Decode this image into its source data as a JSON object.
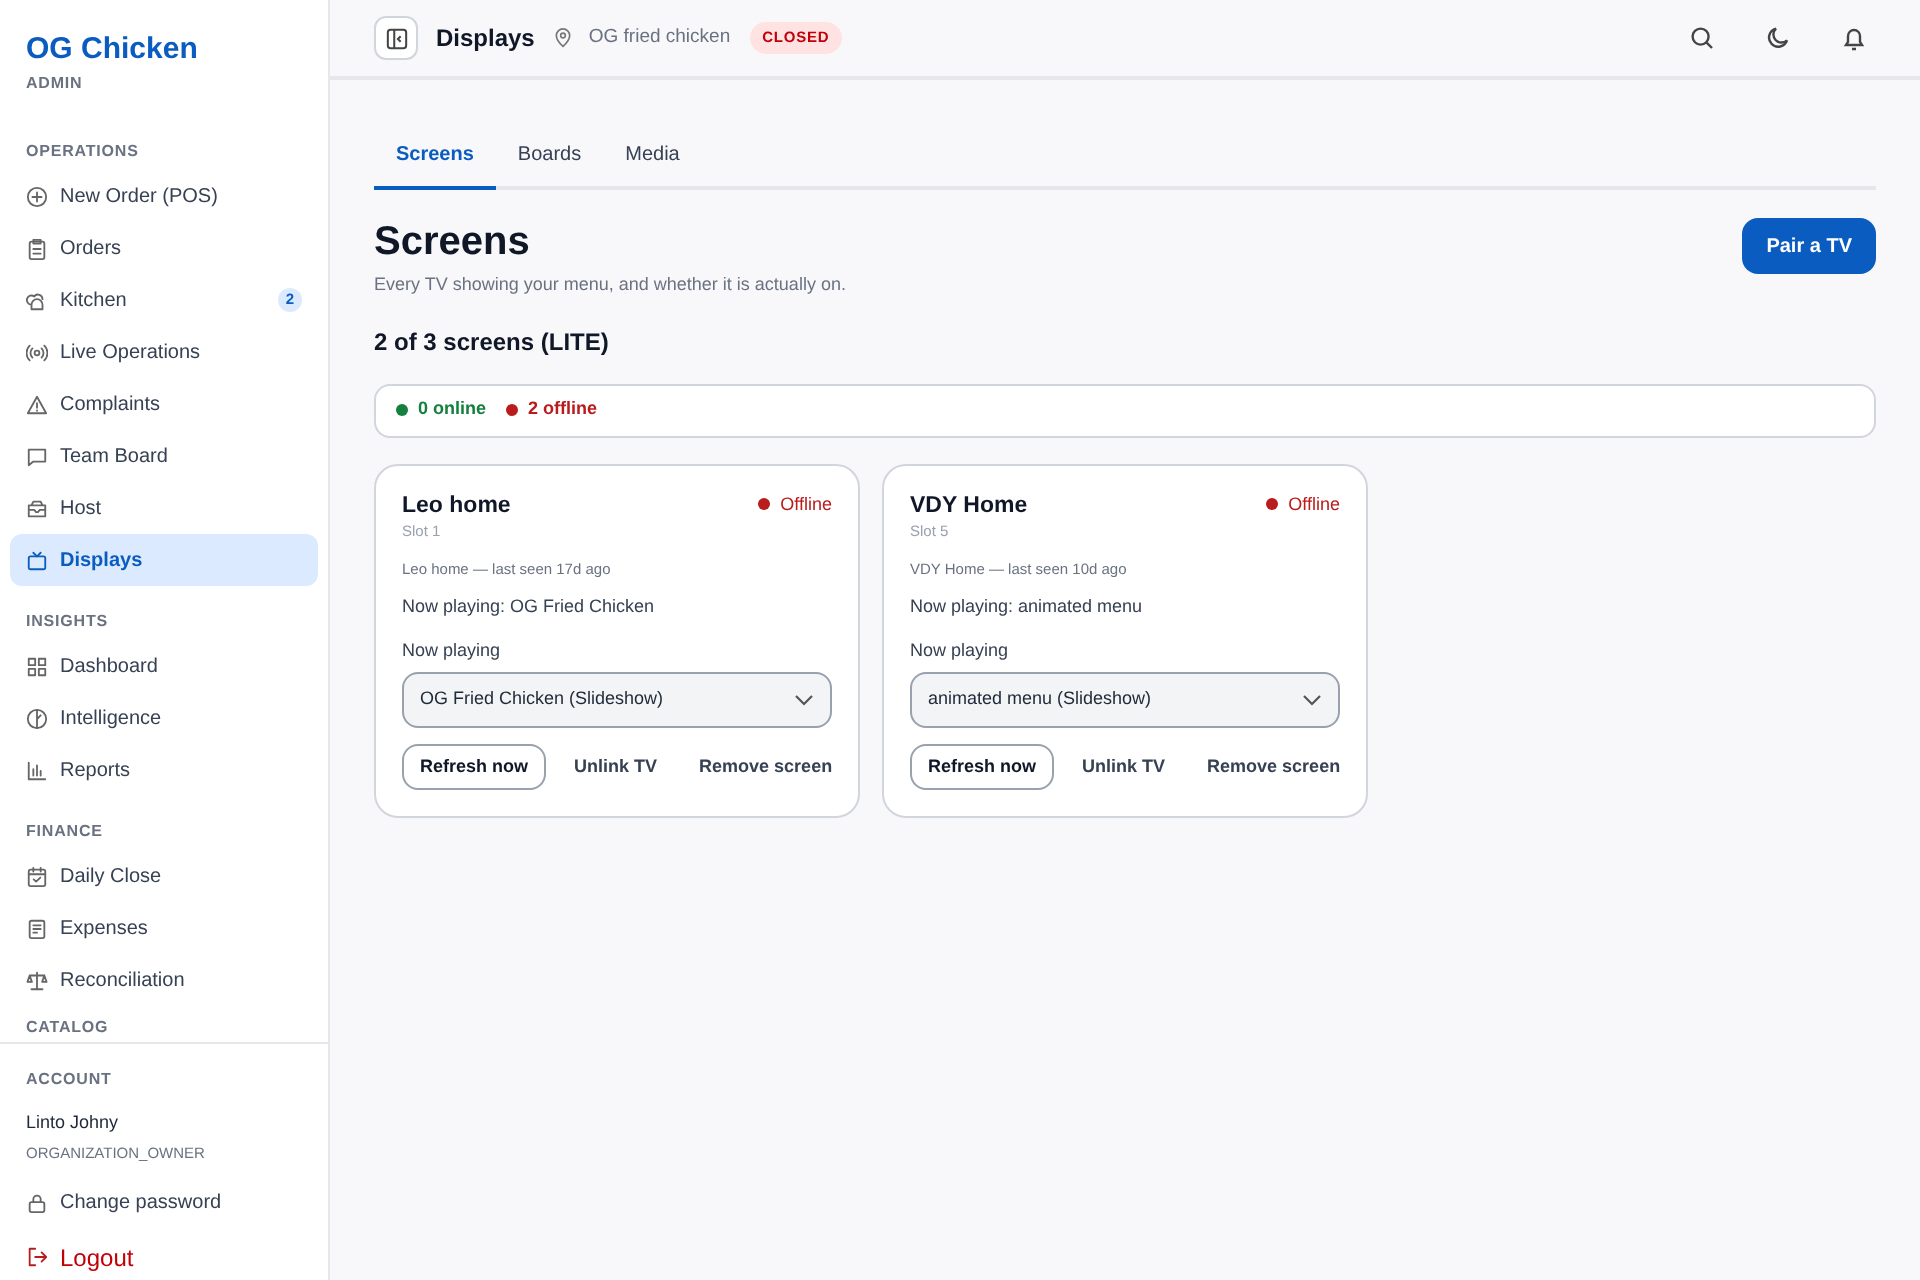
{
  "brand": {
    "name": "OG Chicken",
    "role": "ADMIN"
  },
  "sidebar": {
    "sections": [
      {
        "title": "OPERATIONS",
        "items": [
          {
            "label": "New Order (POS)",
            "selected": false
          },
          {
            "label": "Orders",
            "selected": false
          },
          {
            "label": "Kitchen",
            "selected": false,
            "badge": "2"
          },
          {
            "label": "Live Operations",
            "selected": false
          },
          {
            "label": "Complaints",
            "selected": false
          },
          {
            "label": "Team Board",
            "selected": false
          },
          {
            "label": "Host",
            "selected": false
          },
          {
            "label": "Displays",
            "selected": true
          }
        ]
      },
      {
        "title": "INSIGHTS",
        "items": [
          {
            "label": "Dashboard",
            "selected": false
          },
          {
            "label": "Intelligence",
            "selected": false
          },
          {
            "label": "Reports",
            "selected": false
          }
        ]
      },
      {
        "title": "FINANCE",
        "items": [
          {
            "label": "Daily Close",
            "selected": false
          },
          {
            "label": "Expenses",
            "selected": false
          },
          {
            "label": "Reconciliation",
            "selected": false
          }
        ]
      },
      {
        "title": "CATALOG"
      }
    ]
  },
  "account": {
    "title": "ACCOUNT",
    "user": "Linto Johny",
    "role": "ORGANIZATION_OWNER",
    "change_password": "Change password",
    "logout": "Logout"
  },
  "header": {
    "title": "Displays",
    "location": "OG fried chicken",
    "status": "CLOSED"
  },
  "tabs": [
    {
      "label": "Screens",
      "selected": true
    },
    {
      "label": "Boards",
      "selected": false
    },
    {
      "label": "Media",
      "selected": false
    }
  ],
  "page": {
    "title": "Screens",
    "subtitle": "Every TV showing your menu, and whether it is actually on.",
    "count": "2 of 3 screens (LITE)",
    "pair_button": "Pair a TV"
  },
  "summary": [
    {
      "label": "0 online",
      "color": "#15803d"
    },
    {
      "label": "2 offline",
      "color": "#b91c1c"
    }
  ],
  "screens": [
    {
      "name": "Leo home",
      "slot": "Slot 1",
      "status": "Offline",
      "online": false,
      "last_seen": "Leo home — last seen 17d ago",
      "now_playing": "Now playing: OG Fried Chicken",
      "select_label": "Now playing",
      "select_value": "OG Fried Chicken (Slideshow)",
      "actions": [
        "Refresh now",
        "Unlink TV",
        "Remove screen"
      ]
    },
    {
      "name": "VDY Home",
      "slot": "Slot 5",
      "status": "Offline",
      "online": false,
      "last_seen": "VDY Home — last seen 10d ago",
      "now_playing": "Now playing: animated menu",
      "select_label": "Now playing",
      "select_value": "animated menu (Slideshow)",
      "actions": [
        "Refresh now",
        "Unlink TV",
        "Remove screen"
      ]
    }
  ]
}
